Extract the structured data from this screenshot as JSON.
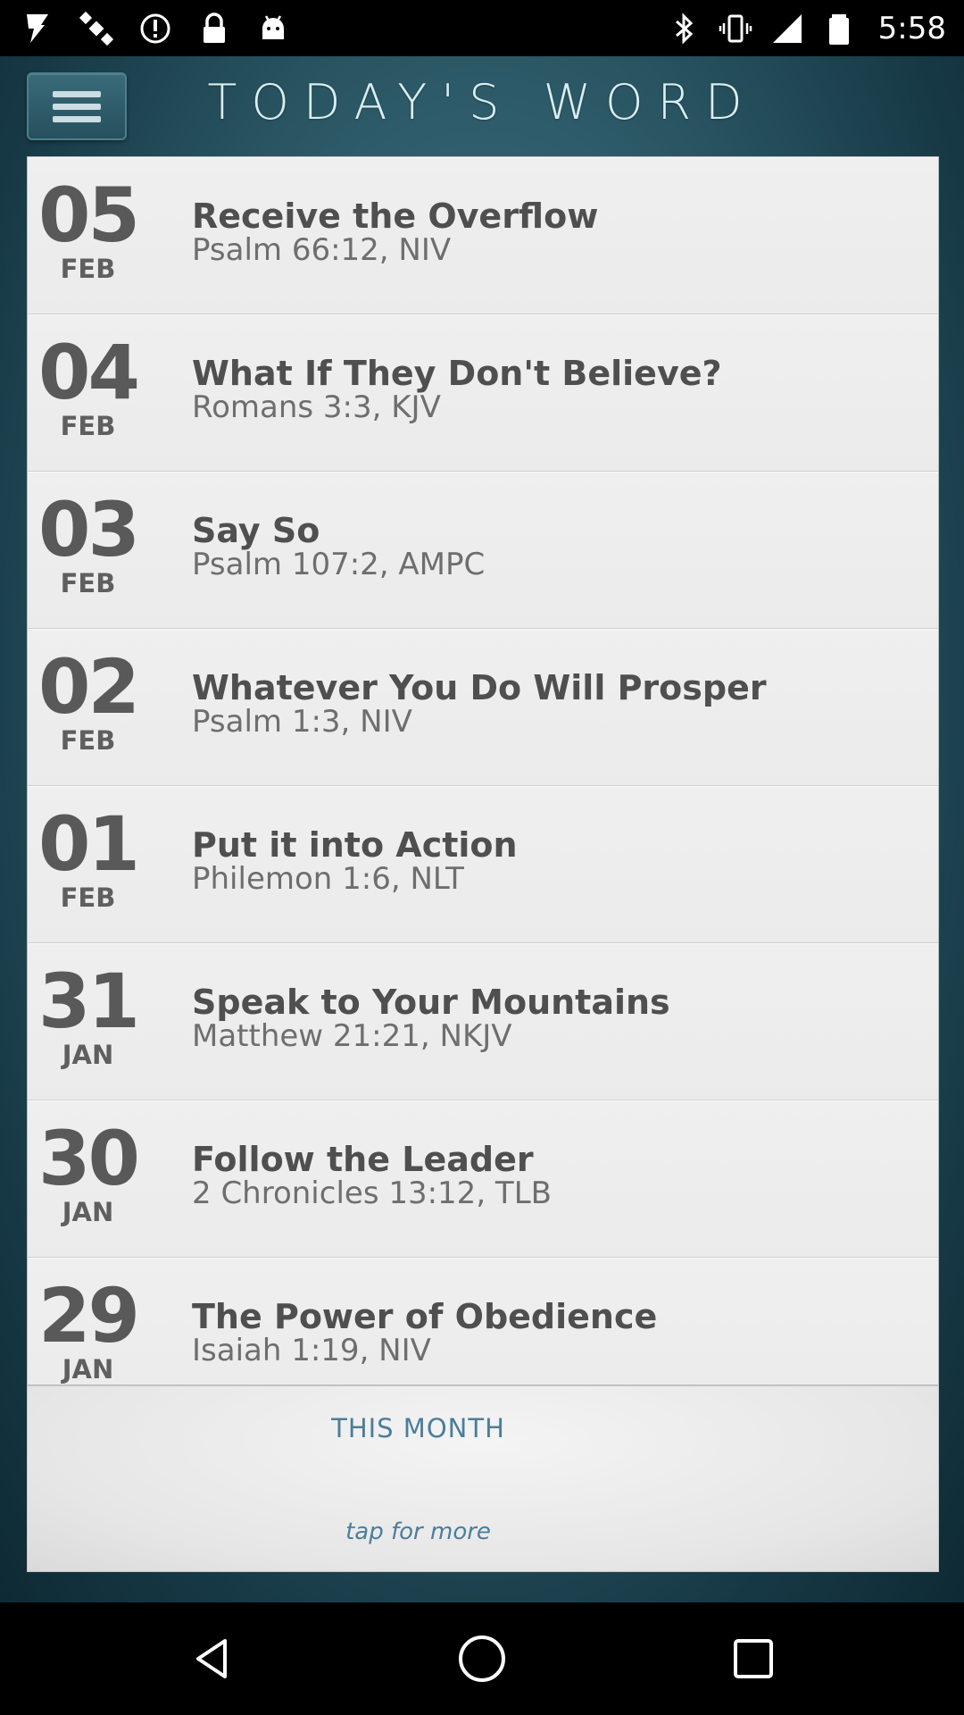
{
  "status_bar": {
    "time": "5:58",
    "left_icons": [
      "fake-gps-icon",
      "satellite-icon",
      "alert-circle-icon",
      "lock-icon",
      "android-icon"
    ],
    "right_icons": [
      "bluetooth-icon",
      "vibrate-icon",
      "signal-icon",
      "battery-icon"
    ]
  },
  "header": {
    "title": "TODAY'S WORD",
    "menu_icon": "menu-icon"
  },
  "entries": [
    {
      "day": "05",
      "month": "FEB",
      "title": "Receive the Overflow",
      "reference": "Psalm 66:12, NIV"
    },
    {
      "day": "04",
      "month": "FEB",
      "title": "What If They Don't Believe?",
      "reference": "Romans 3:3, KJV"
    },
    {
      "day": "03",
      "month": "FEB",
      "title": "Say So",
      "reference": "Psalm 107:2, AMPC"
    },
    {
      "day": "02",
      "month": "FEB",
      "title": "Whatever You Do Will Prosper",
      "reference": "Psalm 1:3, NIV"
    },
    {
      "day": "01",
      "month": "FEB",
      "title": "Put it into Action",
      "reference": "Philemon 1:6, NLT"
    },
    {
      "day": "31",
      "month": "JAN",
      "title": "Speak to Your Mountains",
      "reference": "Matthew 21:21, NKJV"
    },
    {
      "day": "30",
      "month": "JAN",
      "title": "Follow the Leader",
      "reference": "2 Chronicles 13:12, TLB"
    },
    {
      "day": "29",
      "month": "JAN",
      "title": "The Power of Obedience",
      "reference": "Isaiah 1:19, NIV"
    }
  ],
  "footer": {
    "section_label": "THIS MONTH",
    "tap_label": "tap for more"
  },
  "nav_bar": {
    "icons": [
      "back-icon",
      "home-icon",
      "recents-icon"
    ]
  },
  "colors": {
    "accent": "#4a7e9b",
    "header_bg": "#2d5a68"
  }
}
